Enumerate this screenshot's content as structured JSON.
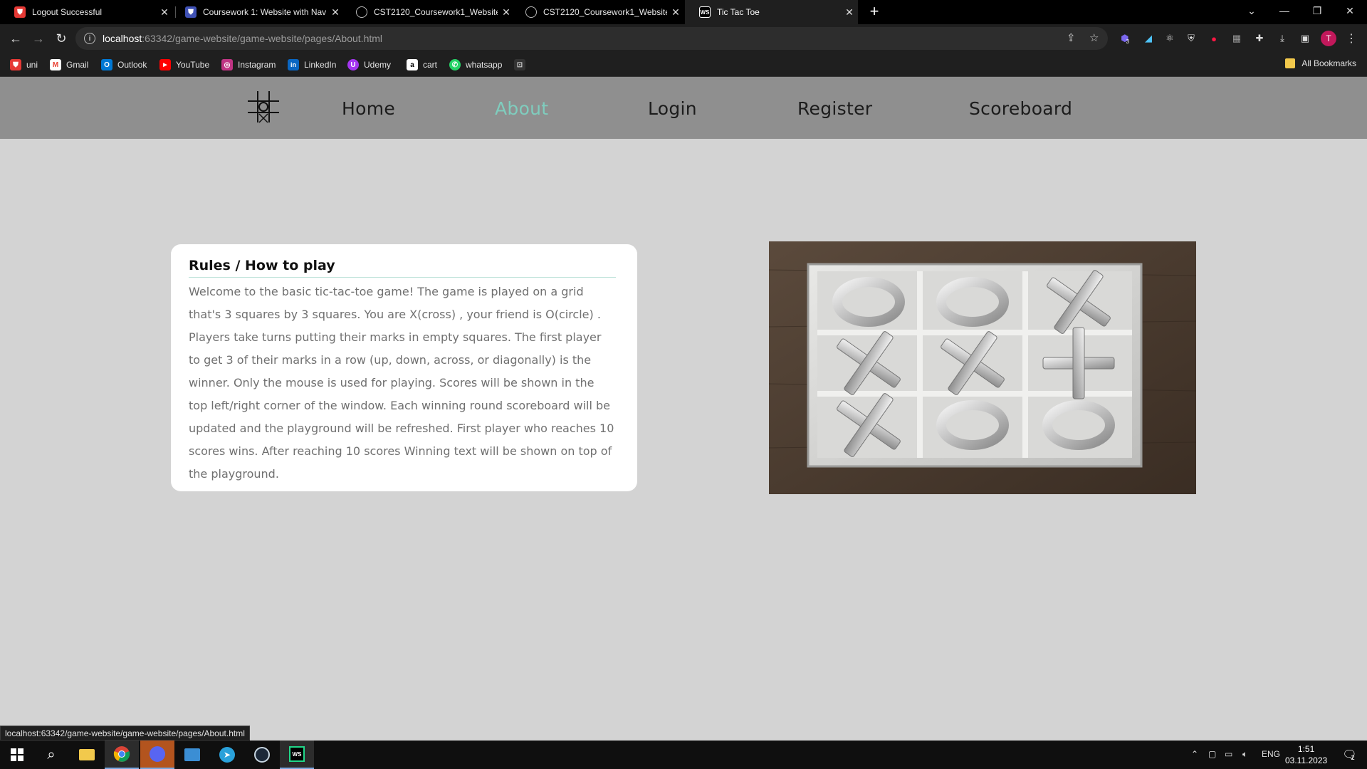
{
  "browser": {
    "tabs": [
      {
        "title": "Logout Successful",
        "favicon": "shield-icon",
        "color": "#e53935"
      },
      {
        "title": "Coursework 1: Website with Nav",
        "favicon": "shield-icon",
        "color": "#3f51b5"
      },
      {
        "title": "CST2120_Coursework1_Website",
        "favicon": "globe-icon",
        "color": "#9e9e9e"
      },
      {
        "title": "CST2120_Coursework1_Website",
        "favicon": "globe-icon",
        "color": "#9e9e9e"
      },
      {
        "title": "Tic Tac Toe",
        "favicon": "ws-icon",
        "color": "#2979ff"
      }
    ],
    "url_host": "localhost",
    "url_rest": ":63342/game-website/game-website/pages/About.html",
    "profile_initial": "T",
    "ext_badge": "3",
    "bookmarks": [
      {
        "label": "uni",
        "color": "#e53935",
        "glyph": "U"
      },
      {
        "label": "Gmail",
        "color": "#ea4335",
        "glyph": "M"
      },
      {
        "label": "Outlook",
        "color": "#0078d4",
        "glyph": "O"
      },
      {
        "label": "YouTube",
        "color": "#ff0000",
        "glyph": "▶"
      },
      {
        "label": "Instagram",
        "color": "#c13584",
        "glyph": "◎"
      },
      {
        "label": "LinkedIn",
        "color": "#0a66c2",
        "glyph": "in"
      },
      {
        "label": "Udemy",
        "color": "#a435f0",
        "glyph": "U"
      },
      {
        "label": "cart",
        "color": "#232f3e",
        "glyph": "a"
      },
      {
        "label": "whatsapp",
        "color": "#25d366",
        "glyph": "W"
      },
      {
        "label": "",
        "color": "#444",
        "glyph": "⊡"
      }
    ],
    "all_bookmarks_label": "All Bookmarks",
    "status_url": "localhost:63342/game-website/game-website/pages/About.html"
  },
  "site": {
    "nav": [
      {
        "label": "Home",
        "current": false
      },
      {
        "label": "About",
        "current": true
      },
      {
        "label": "Login",
        "current": false
      },
      {
        "label": "Register",
        "current": false
      },
      {
        "label": "Scoreboard",
        "current": false
      }
    ],
    "accent_color": "#7fcdbe",
    "rules_title": "Rules / How to play",
    "rules_text": "Welcome to the basic tic-tac-toe game! The game is played on a grid that's 3 squares by 3 squares. You are X(cross) , your friend is O(circle) . Players take turns putting their marks in empty squares. The first player to get 3 of their marks in a row (up, down, across, or diagonally) is the winner. Only the mouse is used for playing. Scores will be shown in the top left/right corner of the window. Each winning round scoreboard will be updated and the playground will be refreshed. First player who reaches 10 scores wins. After reaching 10 scores Winning text will be shown on top of the playground.",
    "board_image": [
      "O",
      "O",
      "X",
      "X",
      "X",
      "+",
      "X",
      "O",
      "O"
    ]
  },
  "taskbar": {
    "lang": "ENG",
    "time": "1:51",
    "date": "03.11.2023",
    "notification_count": "2"
  }
}
